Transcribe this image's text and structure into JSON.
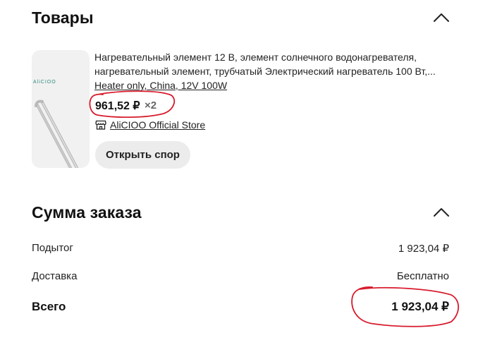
{
  "products_section": {
    "title": "Товары",
    "collapse_icon": "chevron-up-icon"
  },
  "product": {
    "image_icon": "heating-element-image",
    "brand_mark": "AliCIOO",
    "title_line1": "Нагревательный элемент 12 В, элемент солнечного водонагревателя,",
    "title_line2": "нагревательный элемент, трубчатый Электрический нагреватель 100 Вт,...",
    "variant": "Heater only, China, 12V 100W",
    "price": "961,52 ₽",
    "quantity": "×2",
    "store_icon": "store-icon",
    "store_name": "AliCIOO Official Store",
    "dispute_button": "Открыть спор"
  },
  "summary_section": {
    "title": "Сумма заказа",
    "collapse_icon": "chevron-up-icon",
    "subtotal_label": "Подытог",
    "subtotal_value": "1 923,04 ₽",
    "shipping_label": "Доставка",
    "shipping_value": "Бесплатно",
    "total_label": "Всего",
    "total_value": "1 923,04 ₽"
  },
  "colors": {
    "annotation_red": "#d81b2c",
    "button_bg": "#ececec",
    "thumb_bg": "#f1f1f1"
  }
}
